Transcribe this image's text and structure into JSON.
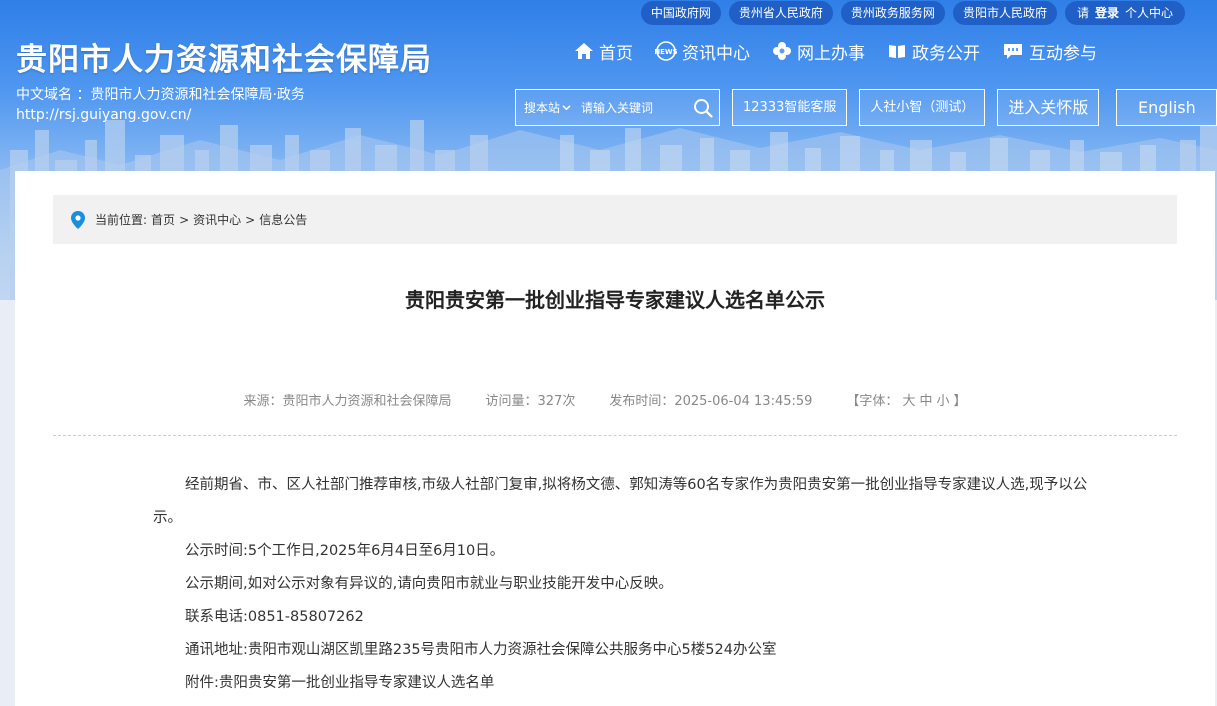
{
  "toplinks": {
    "links": [
      "中国政府网",
      "贵州省人民政府",
      "贵州政务服务网",
      "贵阳市人民政府"
    ],
    "login_prefix": "请",
    "login": "登录",
    "personal_center": "个人中心"
  },
  "header": {
    "site_title": "贵阳市人力资源和社会保障局",
    "domain_label": "中文域名 ：贵阳市人力资源和社会保障局·政务",
    "domain_url": "http://rsj.guiyang.gov.cn/"
  },
  "nav": {
    "items": [
      {
        "label": "首页",
        "icon": "home-icon"
      },
      {
        "label": "资讯中心",
        "icon": "news-icon"
      },
      {
        "label": "网上办事",
        "icon": "flower-icon"
      },
      {
        "label": "政务公开",
        "icon": "book-icon"
      },
      {
        "label": "互动参与",
        "icon": "chat-icon"
      }
    ]
  },
  "tools": {
    "search_scope": "搜本站",
    "search_placeholder": "请输入关键词",
    "service_12333": "12333智能客服",
    "ai_assistant": "人社小智（测试）",
    "care_mode": "进入关怀版",
    "english": "English"
  },
  "breadcrumb": {
    "prefix": "当前位置:",
    "items": [
      "首页",
      "资讯中心",
      "信息公告"
    ],
    "separator": ">"
  },
  "article": {
    "title": "贵阳贵安第一批创业指导专家建议人选名单公示",
    "source": "来源：贵阳市人力资源和社会保障局",
    "views": "访问量：327次",
    "publish_time": "发布时间：2025-06-04 13:45:59",
    "font_label_open": "【字体：",
    "font_large": "大",
    "font_medium": "中",
    "font_small": "小",
    "font_label_close": "】",
    "paragraphs": [
      "经前期省、市、区人社部门推荐审核,市级人社部门复审,拟将杨文德、郭知涛等60名专家作为贵阳贵安第一批创业指导专家建议人选,现予以公示。",
      "公示时间:5个工作日,2025年6月4日至6月10日。",
      "公示期间,如对公示对象有异议的,请向贵阳市就业与职业技能开发中心反映。",
      "联系电话:0851-85807262",
      "通讯地址:贵阳市观山湖区凯里路235号贵阳市人力资源社会保障公共服务中心5楼524办公室",
      "附件:贵阳贵安第一批创业指导专家建议人选名单"
    ]
  },
  "colors": {
    "header_blue": "#2f7fe8",
    "toplink_bg": "#1f5fc6",
    "location_pin": "#1a8fe0"
  }
}
